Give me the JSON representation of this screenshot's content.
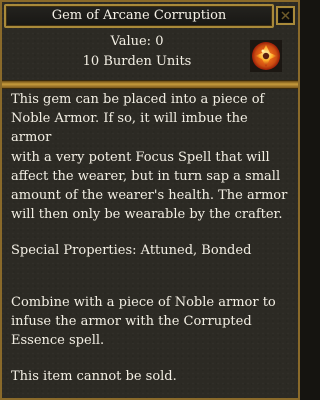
{
  "window": {
    "title": "Gem of Arcane Corruption"
  },
  "item": {
    "value_text": "Value: 0",
    "burden_text": "10 Burden Units",
    "icon": "gem-icon",
    "description": "This gem can be placed into a piece of\nNoble Armor. If so, it will imbue the armor\nwith a very potent Focus Spell that will\naffect the wearer, but in turn sap a small\namount of the wearer's health. The armor\nwill then only be wearable by the crafter.",
    "special_properties": "Special Properties: Attuned, Bonded",
    "usage": "Combine with a piece of Noble armor to\ninfuse the armor with the Corrupted\nEssence spell.",
    "sell_note": "This item cannot be sold."
  },
  "colors": {
    "frame_gold": "#a98a3a",
    "panel_background": "#2c2a24",
    "text": "#f3efe4"
  }
}
